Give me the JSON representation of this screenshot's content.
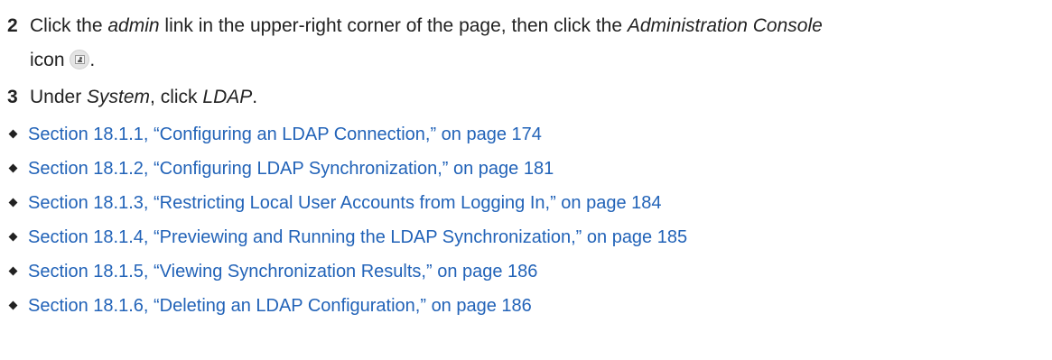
{
  "steps": [
    {
      "number": "2",
      "parts": [
        {
          "text": "Click the ",
          "italic": false
        },
        {
          "text": "admin",
          "italic": true
        },
        {
          "text": " link in the upper-right corner of the page, then click the ",
          "italic": false
        },
        {
          "text": "Administration Console",
          "italic": true
        }
      ],
      "continuation": "icon",
      "icon_name": "administration-console-icon",
      "trailing": "."
    },
    {
      "number": "3",
      "parts": [
        {
          "text": "Under ",
          "italic": false
        },
        {
          "text": "System",
          "italic": true
        },
        {
          "text": ", click ",
          "italic": false
        },
        {
          "text": "LDAP",
          "italic": true
        },
        {
          "text": ".",
          "italic": false
        }
      ]
    }
  ],
  "links": [
    {
      "label": "Section 18.1.1, “Configuring an LDAP Connection,” on page 174"
    },
    {
      "label": "Section 18.1.2, “Configuring LDAP Synchronization,” on page 181"
    },
    {
      "label": "Section 18.1.3, “Restricting Local User Accounts from Logging In,” on page 184"
    },
    {
      "label": "Section 18.1.4, “Previewing and Running the LDAP Synchronization,” on page 185"
    },
    {
      "label": "Section 18.1.5, “Viewing Synchronization Results,” on page 186"
    },
    {
      "label": "Section 18.1.6, “Deleting an LDAP Configuration,” on page 186"
    }
  ],
  "colors": {
    "link": "#2263b8",
    "text": "#222222"
  }
}
